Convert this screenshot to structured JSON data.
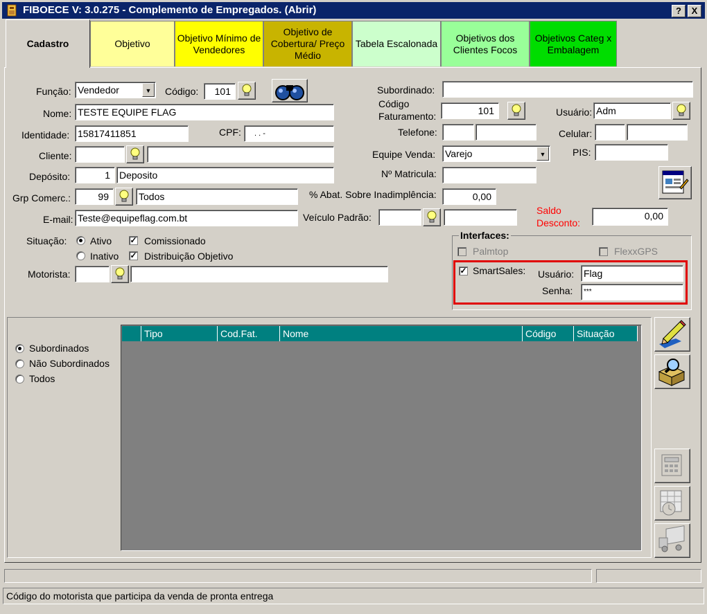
{
  "window": {
    "title": "FIBOECE V: 3.0.275 - Complemento de Empregados. (Abrir)",
    "help_btn": "?",
    "close_btn": "X"
  },
  "tabs": [
    {
      "label": "Cadastro",
      "color": "#d4d0c8"
    },
    {
      "label": "Objetivo",
      "color": "#ffff99"
    },
    {
      "label": "Objetivo Mínimo de Vendedores",
      "color": "#ffff00"
    },
    {
      "label": "Objetivo de Cobertura/ Preço Médio",
      "color": "#c8b400"
    },
    {
      "label": "Tabela Escalonada",
      "color": "#ccffcc"
    },
    {
      "label": "Objetivos dos Clientes Focos",
      "color": "#99ff99"
    },
    {
      "label": "Objetivos Categ x Embalagem",
      "color": "#00dd00"
    }
  ],
  "form": {
    "funcao": {
      "label": "Função:",
      "value": "Vendedor"
    },
    "codigo": {
      "label": "Código:",
      "value": "101"
    },
    "nome": {
      "label": "Nome:",
      "value": "TESTE EQUIPE FLAG"
    },
    "identidade": {
      "label": "Identidade:",
      "value": "15817411851"
    },
    "cpf": {
      "label": "CPF:",
      "value": ".    .    -"
    },
    "cliente": {
      "label": "Cliente:",
      "code": "",
      "name": ""
    },
    "deposito": {
      "label": "Depósito:",
      "code": "1",
      "name": "Deposito"
    },
    "grp_comerc": {
      "label": "Grp Comerc.:",
      "code": "99",
      "name": "Todos"
    },
    "email": {
      "label": "E-mail:",
      "value": "Teste@equipeflag.com.bt"
    },
    "situacao": {
      "label": "Situação:",
      "ativo": "Ativo",
      "inativo": "Inativo",
      "comissionado": "Comissionado",
      "distribuicao": "Distribuição Objetivo"
    },
    "motorista": {
      "label": "Motorista:",
      "code": "",
      "name": ""
    },
    "subordinado": {
      "label": "Subordinado:",
      "value": ""
    },
    "codigo_fat": {
      "label_line1": "Código",
      "label_line2": "Faturamento:",
      "value": "101"
    },
    "usuario": {
      "label": "Usuário:",
      "value": "Adm"
    },
    "telefone": {
      "label": "Telefone:",
      "ddd": "",
      "value": ""
    },
    "celular": {
      "label": "Celular:",
      "ddd": "",
      "value": ""
    },
    "equipe_venda": {
      "label": "Equipe Venda:",
      "value": "Varejo"
    },
    "pis": {
      "label": "PIS:",
      "value": ""
    },
    "matricula": {
      "label": "Nº Matricula:",
      "value": ""
    },
    "abat": {
      "label": "% Abat. Sobre Inadimplência:",
      "value": "0,00"
    },
    "veiculo": {
      "label": "Veículo Padrão:",
      "code": "",
      "name": ""
    },
    "saldo": {
      "label_line1": "Saldo",
      "label_line2": "Desconto:",
      "value": "0,00",
      "color": "#ff0000"
    }
  },
  "interfaces": {
    "title": "Interfaces:",
    "palmtop": "Palmtop",
    "flexgps": "FlexxGPS",
    "smartsales": "SmartSales:",
    "usuario_label": "Usuário:",
    "usuario_value": "Flag",
    "senha_label": "Senha:",
    "senha_value": "***",
    "highlight_color": "#e00000"
  },
  "subordinados": {
    "options": [
      "Subordinados",
      "Não Subordinados",
      "Todos"
    ],
    "columns": [
      "Tipo",
      "Cod.Fat.",
      "Nome",
      "Código",
      "Situação"
    ]
  },
  "statusbar": {
    "message": "Código do motorista que participa da venda de pronta entrega"
  }
}
